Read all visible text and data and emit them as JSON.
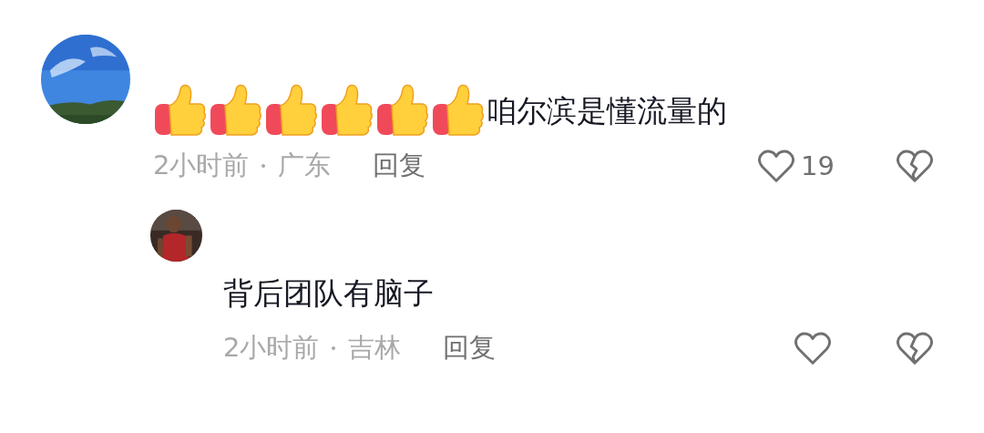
{
  "comments": [
    {
      "emojis": [
        {
          "kind": "thumbs-up"
        },
        {
          "kind": "thumbs-up"
        },
        {
          "kind": "thumbs-up"
        },
        {
          "kind": "thumbs-up"
        },
        {
          "kind": "thumbs-up"
        },
        {
          "kind": "thumbs-up"
        }
      ],
      "text": "咱尔滨是懂流量的",
      "time": "2小时前",
      "location": "广东",
      "reply": "回复",
      "likes": "19",
      "liked": false,
      "disliked": false,
      "is_reply": false
    },
    {
      "text": "背后团队有脑子",
      "time": "2小时前",
      "location": "吉林",
      "reply": "回复",
      "liked": false,
      "disliked": false,
      "is_reply": true
    }
  ]
}
